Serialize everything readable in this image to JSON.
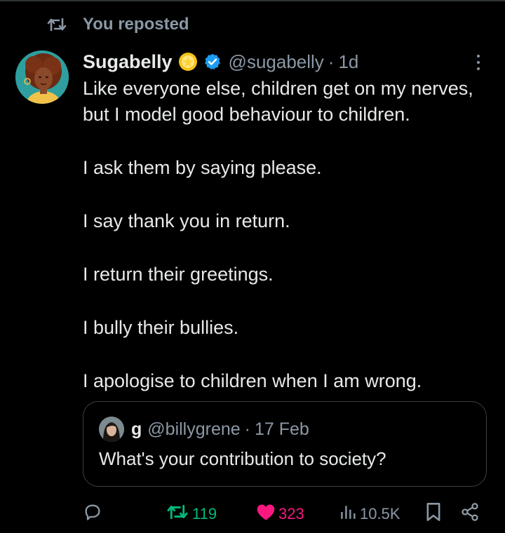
{
  "colors": {
    "background": "#000000",
    "text": "#e7e9ea",
    "muted": "#8b98a5",
    "repost_green": "#00ba7c",
    "like_pink": "#f91880",
    "verified_blue": "#1d9bf0"
  },
  "repost_banner": {
    "label": "You reposted",
    "icon": "repost-icon"
  },
  "tweet": {
    "author_name": "Sugabelly",
    "author_emoji": "glowing-star-emoji",
    "handle": "@sugabelly",
    "separator": "·",
    "time": "1d",
    "paragraphs": [
      "Like everyone else, children get on my nerves, but I model good behaviour to children.",
      "I ask them by saying please.",
      "I say thank you in return.",
      "I return their greetings.",
      "I bully their bullies.",
      "I apologise to children when I am wrong."
    ]
  },
  "quoted_tweet": {
    "author_name": "g",
    "handle": "@billygrene",
    "separator": "·",
    "time": "17 Feb",
    "text": "What's your contribution to society?"
  },
  "actions": {
    "reply": {
      "icon": "reply-icon",
      "count": ""
    },
    "repost": {
      "icon": "repost-icon",
      "count": "119",
      "active": true
    },
    "like": {
      "icon": "heart-icon",
      "count": "323",
      "active": true
    },
    "views": {
      "icon": "views-icon",
      "count": "10.5K"
    },
    "bookmark": {
      "icon": "bookmark-icon"
    },
    "share": {
      "icon": "share-icon"
    }
  }
}
